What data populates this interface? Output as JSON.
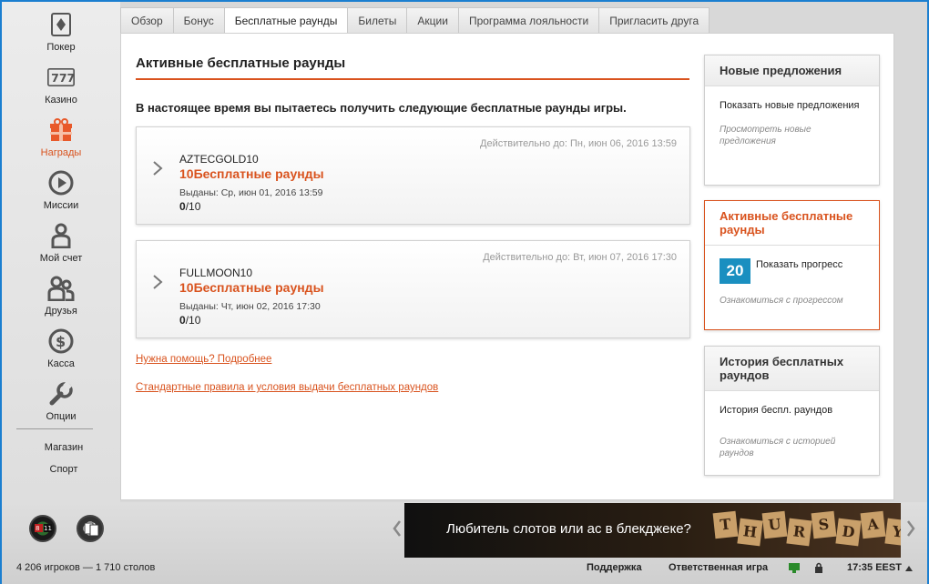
{
  "nav": {
    "items": [
      {
        "label": "Покер",
        "icon": "diamond-card-icon"
      },
      {
        "label": "Казино",
        "icon": "slot-777-icon"
      },
      {
        "label": "Награды",
        "icon": "gift-icon"
      },
      {
        "label": "Миссии",
        "icon": "play-circle-icon"
      },
      {
        "label": "Мой счет",
        "icon": "user-icon"
      },
      {
        "label": "Друзья",
        "icon": "friends-icon"
      },
      {
        "label": "Касса",
        "icon": "dollar-icon"
      },
      {
        "label": "Опции",
        "icon": "wrench-icon"
      }
    ],
    "shop": "Магазин",
    "sport": "Спорт"
  },
  "tabs": [
    "Обзор",
    "Бонус",
    "Бесплатные раунды",
    "Билеты",
    "Акции",
    "Программа лояльности",
    "Пригласить друга"
  ],
  "main": {
    "title": "Активные бесплатные раунды",
    "subtitle": "В настоящее время вы пытаетесь получить следующие бесплатные раунды игры.",
    "cards": [
      {
        "valid": "Действительно до: Пн, июн 06, 2016 13:59",
        "code": "AZTECGOLD10",
        "rounds": "10Бесплатные раунды",
        "issued": "Выданы: Ср, июн 01, 2016 13:59",
        "progress_done": "0",
        "progress_total": "/10"
      },
      {
        "valid": "Действительно до: Вт, июн 07, 2016 17:30",
        "code": "FULLMOON10",
        "rounds": "10Бесплатные раунды",
        "issued": "Выданы: Чт, июн 02, 2016 17:30",
        "progress_done": "0",
        "progress_total": "/10"
      }
    ],
    "help_link": "Нужна помощь? Подробнее",
    "terms_link": "Стандартные правила и условия выдачи бесплатных раундов"
  },
  "sidebar": {
    "offers": {
      "title": "Новые предложения",
      "body": "Показать новые предложения",
      "link": "Просмотреть новые предложения"
    },
    "active": {
      "title": "Активные бесплатные раунды",
      "badge": "20",
      "body": "Показать прогресс",
      "link": "Ознакомиться с прогрессом"
    },
    "history": {
      "title": "История бесплатных раундов",
      "body": "История беспл. раундов",
      "link": "Ознакомиться с историей раундов"
    }
  },
  "banner": {
    "text": "Любитель слотов или ас в блекджеке?",
    "word": [
      "T",
      "H",
      "U",
      "R",
      "S",
      "D",
      "A",
      "Y",
      "S"
    ]
  },
  "status": {
    "players": "4 206 игроков — 1 710 столов",
    "support": "Поддержка",
    "responsible": "Ответственная игра",
    "time": "17:35 EEST"
  },
  "colors": {
    "accent": "#d9531e",
    "badge": "#1a8fc0"
  }
}
